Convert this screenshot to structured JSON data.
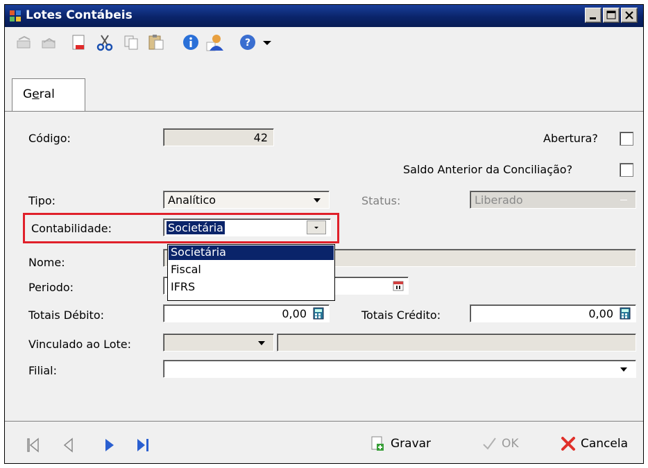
{
  "window": {
    "title": "Lotes Contábeis"
  },
  "toolbar": {
    "icons": [
      "undo-icon",
      "redo-icon",
      "new-document-icon",
      "cut-icon",
      "copy-icon",
      "paste-icon",
      "info-icon",
      "user-icon",
      "help-icon",
      "dropdown-arrow-icon"
    ]
  },
  "tabs": [
    {
      "label": "Geral",
      "accel": "e"
    }
  ],
  "form": {
    "codigo_label": "Código:",
    "codigo_value": "42",
    "abertura_label": "Abertura?",
    "saldo_label": "Saldo Anterior da Conciliação?",
    "tipo_label": "Tipo:",
    "tipo_value": "Analítico",
    "status_label": "Status:",
    "status_value": "Liberado",
    "contabilidade_label": "Contabilidade:",
    "contabilidade_value": "Societária",
    "contabilidade_options": [
      "Societária",
      "Fiscal",
      "IFRS"
    ],
    "nome_label": "Nome:",
    "periodo_label": "Periodo:",
    "totais_debito_label": "Totais Débito:",
    "totais_debito_value": "0,00",
    "totais_credito_label": "Totais Crédito:",
    "totais_credito_value": "0,00",
    "vinculado_label": "Vinculado ao Lote:",
    "filial_label": "Filial:"
  },
  "footer": {
    "gravar_label": "Gravar",
    "ok_label": "OK",
    "cancela_label": "Cancela"
  },
  "colors": {
    "title_bar": "#0a246a",
    "highlight": "#e0202a",
    "selection": "#0a246a"
  }
}
